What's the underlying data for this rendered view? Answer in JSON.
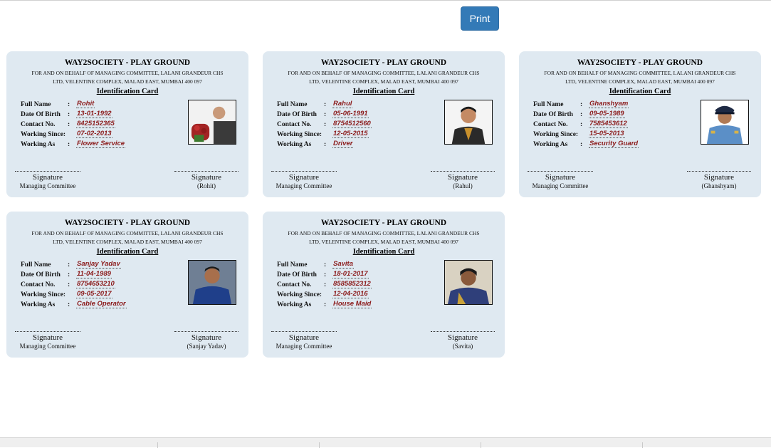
{
  "toolbar": {
    "print_label": "Print"
  },
  "card_common": {
    "title": "WAY2SOCIETY - PLAY GROUND",
    "subtitle_line1": "FOR AND ON BEHALF OF MANAGING COMMITTEE, LALANI GRANDEUR CHS",
    "subtitle_line2": "LTD, VELENTINE COMPLEX, MALAD EAST, MUMBAI 400 097",
    "heading": "Identification Card",
    "labels": {
      "full_name": "Full Name",
      "dob": "Date Of Birth",
      "contact": "Contact No.",
      "since": "Working Since:",
      "working_as": "Working As"
    },
    "colon": ":",
    "signature": "Signature",
    "managing_committee": "Managing Committee"
  },
  "cards": [
    {
      "name": "Rohit",
      "dob": "13-01-1992",
      "contact": "8425152365",
      "since": "07-02-2013",
      "working_as": "Flower Service",
      "signer": "(Rohit)"
    },
    {
      "name": "Rahul",
      "dob": "05-06-1991",
      "contact": "8754512560",
      "since": "12-05-2015",
      "working_as": "Driver",
      "signer": "(Rahul)"
    },
    {
      "name": "Ghanshyam",
      "dob": "09-05-1989",
      "contact": "7585453612",
      "since": "15-05-2013",
      "working_as": "Security Guard",
      "signer": "(Ghanshyam)"
    },
    {
      "name": "Sanjay Yadav",
      "dob": "11-04-1989",
      "contact": "8754653210",
      "since": "09-05-2017",
      "working_as": "Cable Operator",
      "signer": "(Sanjay Yadav)"
    },
    {
      "name": "Savita",
      "dob": "18-01-2017",
      "contact": "8585852312",
      "since": "12-04-2016",
      "working_as": "House Maid",
      "signer": "(Savita)"
    }
  ],
  "colors": {
    "card_bg": "#dfe9f1",
    "value_text": "#8b1a1a",
    "button_bg": "#337ab7"
  }
}
